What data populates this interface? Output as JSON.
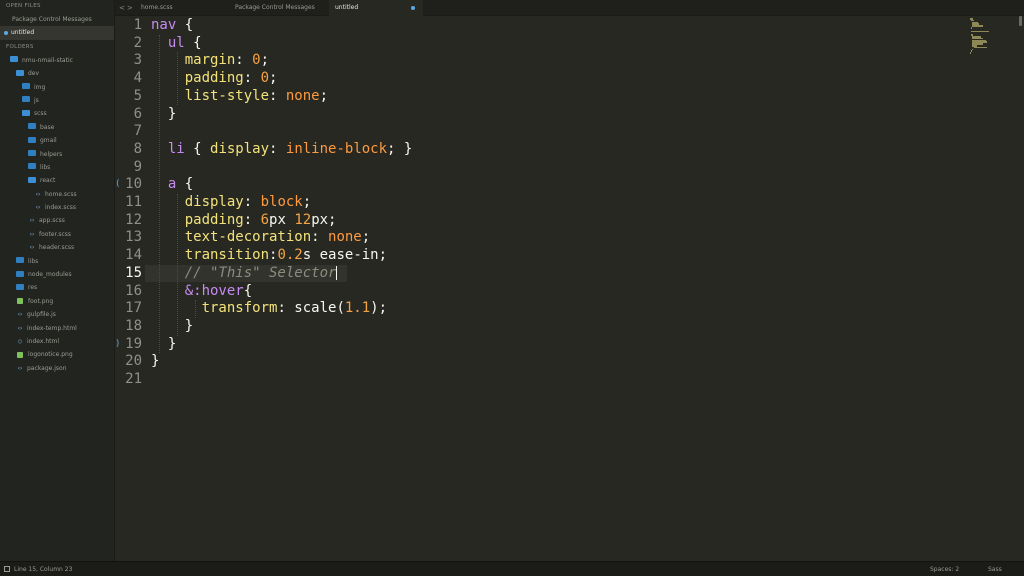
{
  "sidebar": {
    "open_files_header": "OPEN FILES",
    "open_files": [
      {
        "label": "Package Control Messages",
        "active": false
      },
      {
        "label": "untitled",
        "active": true
      }
    ],
    "folders_header": "FOLDERS",
    "tree": [
      {
        "label": "nmu-nmail-static",
        "kind": "folder-open",
        "depth": 0
      },
      {
        "label": "dev",
        "kind": "folder-open",
        "depth": 1
      },
      {
        "label": "img",
        "kind": "folder",
        "depth": 2
      },
      {
        "label": "js",
        "kind": "folder",
        "depth": 2
      },
      {
        "label": "scss",
        "kind": "folder-open",
        "depth": 2
      },
      {
        "label": "base",
        "kind": "folder",
        "depth": 3
      },
      {
        "label": "gmail",
        "kind": "folder",
        "depth": 3
      },
      {
        "label": "helpers",
        "kind": "folder",
        "depth": 3
      },
      {
        "label": "libs",
        "kind": "folder",
        "depth": 3
      },
      {
        "label": "react",
        "kind": "folder-open",
        "depth": 3
      },
      {
        "label": "home.scss",
        "kind": "code-file",
        "depth": 4
      },
      {
        "label": "index.scss",
        "kind": "code-file",
        "depth": 4
      },
      {
        "label": "app.scss",
        "kind": "code-file",
        "depth": 3
      },
      {
        "label": "footer.scss",
        "kind": "code-file",
        "depth": 3
      },
      {
        "label": "header.scss",
        "kind": "code-file",
        "depth": 3
      },
      {
        "label": "libs",
        "kind": "folder",
        "depth": 1
      },
      {
        "label": "node_modules",
        "kind": "folder",
        "depth": 1
      },
      {
        "label": "res",
        "kind": "folder",
        "depth": 1
      },
      {
        "label": "foot.png",
        "kind": "image-file",
        "depth": 1
      },
      {
        "label": "gulpfile.js",
        "kind": "code-file",
        "depth": 1
      },
      {
        "label": "index-temp.html",
        "kind": "code-file",
        "depth": 1
      },
      {
        "label": "index.html",
        "kind": "html-file",
        "depth": 1
      },
      {
        "label": "logonotice.png",
        "kind": "image-file",
        "depth": 1
      },
      {
        "label": "package.json",
        "kind": "code-file",
        "depth": 1
      }
    ]
  },
  "tabbar": {
    "back_glyph": "<",
    "forward_glyph": ">",
    "tabs": [
      {
        "label": "home.scss",
        "active": false
      },
      {
        "label": "Package Control Messages",
        "active": false
      },
      {
        "label": "untitled",
        "active": true,
        "dirty": true
      }
    ]
  },
  "editor": {
    "current_line": 15,
    "lines": [
      {
        "n": "1",
        "tokens": [
          [
            "kw",
            "nav"
          ],
          [
            "plain",
            " {"
          ]
        ]
      },
      {
        "n": "2",
        "tokens": [
          [
            "plain",
            "  "
          ],
          [
            "kw",
            "ul"
          ],
          [
            "plain",
            " {"
          ]
        ]
      },
      {
        "n": "3",
        "tokens": [
          [
            "plain",
            "    "
          ],
          [
            "prop",
            "margin"
          ],
          [
            "plain",
            ": "
          ],
          [
            "num",
            "0"
          ],
          [
            "plain",
            ";"
          ]
        ]
      },
      {
        "n": "4",
        "tokens": [
          [
            "plain",
            "    "
          ],
          [
            "prop",
            "padding"
          ],
          [
            "plain",
            ": "
          ],
          [
            "num",
            "0"
          ],
          [
            "plain",
            ";"
          ]
        ]
      },
      {
        "n": "5",
        "tokens": [
          [
            "plain",
            "    "
          ],
          [
            "prop",
            "list-style"
          ],
          [
            "plain",
            ": "
          ],
          [
            "val",
            "none"
          ],
          [
            "plain",
            ";"
          ]
        ]
      },
      {
        "n": "6",
        "tokens": [
          [
            "plain",
            "  }"
          ]
        ]
      },
      {
        "n": "7",
        "tokens": []
      },
      {
        "n": "8",
        "tokens": [
          [
            "plain",
            "  "
          ],
          [
            "kw",
            "li"
          ],
          [
            "plain",
            " { "
          ],
          [
            "prop",
            "display"
          ],
          [
            "plain",
            ": "
          ],
          [
            "val",
            "inline-block"
          ],
          [
            "plain",
            "; }"
          ]
        ]
      },
      {
        "n": "9",
        "tokens": []
      },
      {
        "n": "10",
        "tokens": [
          [
            "plain",
            "  "
          ],
          [
            "kw",
            "a"
          ],
          [
            "plain",
            " {"
          ]
        ]
      },
      {
        "n": "11",
        "tokens": [
          [
            "plain",
            "    "
          ],
          [
            "prop",
            "display"
          ],
          [
            "plain",
            ": "
          ],
          [
            "val",
            "block"
          ],
          [
            "plain",
            ";"
          ]
        ]
      },
      {
        "n": "12",
        "tokens": [
          [
            "plain",
            "    "
          ],
          [
            "prop",
            "padding"
          ],
          [
            "plain",
            ": "
          ],
          [
            "num",
            "6"
          ],
          [
            "plain",
            "px "
          ],
          [
            "num",
            "12"
          ],
          [
            "plain",
            "px;"
          ]
        ]
      },
      {
        "n": "13",
        "tokens": [
          [
            "plain",
            "    "
          ],
          [
            "prop",
            "text-decoration"
          ],
          [
            "plain",
            ": "
          ],
          [
            "val",
            "none"
          ],
          [
            "plain",
            ";"
          ]
        ]
      },
      {
        "n": "14",
        "tokens": [
          [
            "plain",
            "    "
          ],
          [
            "prop",
            "transition"
          ],
          [
            "plain",
            ":"
          ],
          [
            "num",
            "0.2"
          ],
          [
            "plain",
            "s ease-in;"
          ]
        ]
      },
      {
        "n": "15",
        "tokens": [
          [
            "plain",
            "    "
          ],
          [
            "cmt",
            "// \"This\" Selector"
          ]
        ]
      },
      {
        "n": "16",
        "tokens": [
          [
            "plain",
            "    "
          ],
          [
            "kw",
            "&:hover"
          ],
          [
            "plain",
            "{"
          ]
        ]
      },
      {
        "n": "17",
        "tokens": [
          [
            "plain",
            "      "
          ],
          [
            "prop",
            "transform"
          ],
          [
            "plain",
            ": scale("
          ],
          [
            "num",
            "1.1"
          ],
          [
            "plain",
            ");"
          ]
        ]
      },
      {
        "n": "18",
        "tokens": [
          [
            "plain",
            "    }"
          ]
        ]
      },
      {
        "n": "19",
        "tokens": [
          [
            "plain",
            "  }"
          ]
        ]
      },
      {
        "n": "20",
        "tokens": [
          [
            "plain",
            "}"
          ]
        ]
      },
      {
        "n": "21",
        "tokens": []
      }
    ],
    "fold_markers": [
      {
        "line": 10,
        "glyph": "("
      },
      {
        "line": 19,
        "glyph": ")"
      }
    ]
  },
  "colors": {
    "background": "#272822",
    "selector": "#c68bf0",
    "property": "#f3e27b",
    "value": "#fd9a3f",
    "comment": "#8c8c7e",
    "accent": "#5aa9e6"
  },
  "statusbar": {
    "position": "Line 15, Column 23",
    "spaces": "Spaces: 2",
    "syntax": "Sass"
  }
}
